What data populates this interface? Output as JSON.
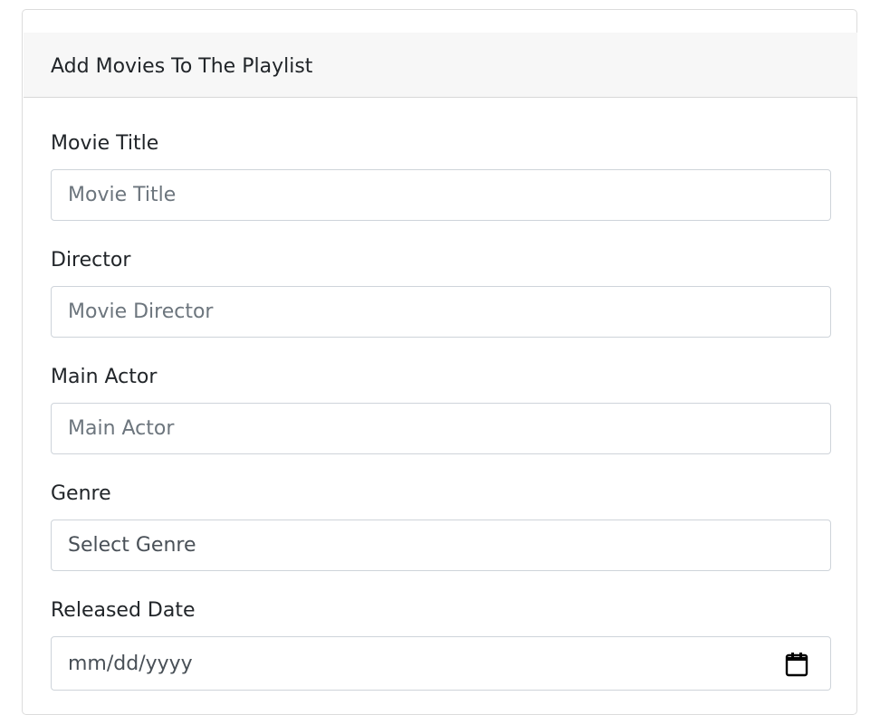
{
  "card": {
    "title": "Add Movies To The Playlist"
  },
  "form": {
    "movie_title": {
      "label": "Movie Title",
      "placeholder": "Movie Title"
    },
    "director": {
      "label": "Director",
      "placeholder": "Movie Director"
    },
    "main_actor": {
      "label": "Main Actor",
      "placeholder": "Main Actor"
    },
    "genre": {
      "label": "Genre",
      "selected": "Select Genre"
    },
    "released_date": {
      "label": "Released Date",
      "placeholder": "mm/dd/yyyy",
      "icon": "calendar-icon"
    }
  },
  "colors": {
    "header_background": "#f7f7f7",
    "input_border": "#ced4da",
    "placeholder": "#6c757d",
    "text": "#212529"
  }
}
